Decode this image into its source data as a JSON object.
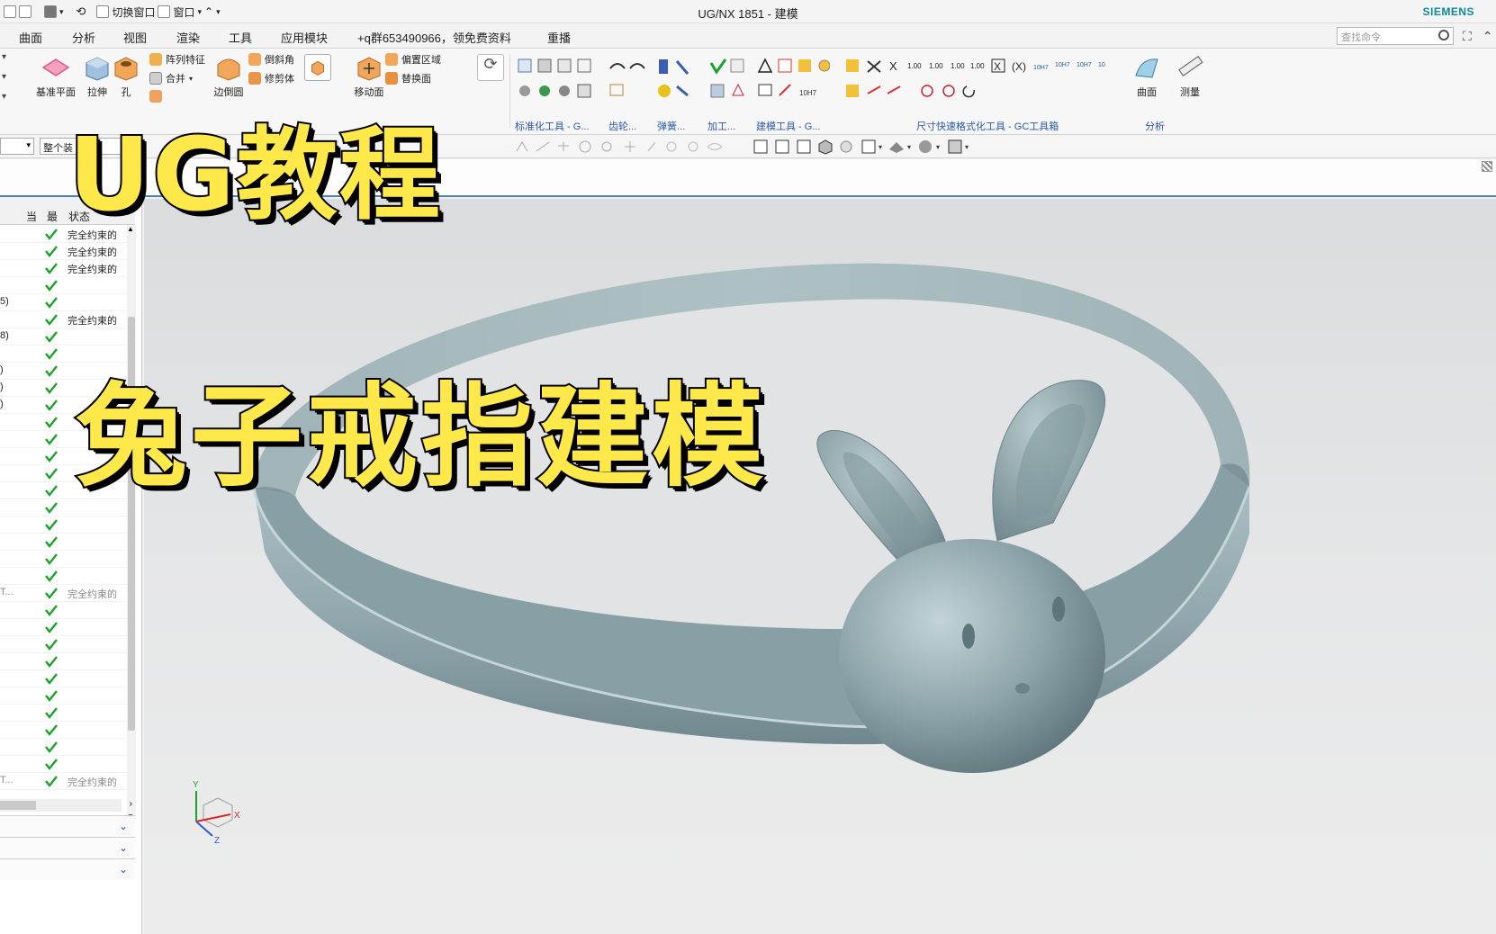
{
  "window": {
    "title": "UG/NX 1851 - 建模",
    "brand": "SIEMENS",
    "quick_access": [
      "切换窗口",
      "窗口"
    ]
  },
  "menu": {
    "items": [
      "曲面",
      "分析",
      "视图",
      "渲染",
      "工具",
      "应用模块",
      "+q群653490966，领免费资料",
      "重播"
    ],
    "search_placeholder": "查找命令"
  },
  "ribbon": {
    "big_buttons": [
      "基准平面",
      "拉伸",
      "孔",
      "边倒圆",
      "移动面",
      "曲面",
      "测量"
    ],
    "small_buttons": [
      "阵列特征",
      "合并",
      "倒斜角",
      "修剪体",
      "偏置区域",
      "替换面"
    ],
    "group_labels": [
      "标准化工具 - G...",
      "齿轮...",
      "弹簧...",
      "加工...",
      "建模工具 - G...",
      "尺寸快速格式化工具 - GC工具箱",
      "分析"
    ]
  },
  "toolbar2": {
    "scope": "整个装"
  },
  "navigator": {
    "headers": [
      "当",
      "最",
      "状态"
    ],
    "rows": [
      {
        "left": "",
        "status": "完全约束的",
        "dim": false
      },
      {
        "left": "",
        "status": "完全约束的",
        "dim": false
      },
      {
        "left": "",
        "status": "完全约束的",
        "dim": false
      },
      {
        "left": "",
        "status": "",
        "dim": false
      },
      {
        "left": "5)",
        "status": "",
        "dim": false
      },
      {
        "left": "",
        "status": "完全约束的",
        "dim": false
      },
      {
        "left": "8)",
        "status": "",
        "dim": false
      },
      {
        "left": "",
        "status": "",
        "dim": false
      },
      {
        "left": ")",
        "status": "",
        "dim": false
      },
      {
        "left": ")",
        "status": "",
        "dim": false
      },
      {
        "left": ")",
        "status": "",
        "dim": false
      },
      {
        "left": "",
        "status": "",
        "dim": false
      },
      {
        "left": "",
        "status": "",
        "dim": false
      },
      {
        "left": "",
        "status": "",
        "dim": false
      },
      {
        "left": "",
        "status": "",
        "dim": false
      },
      {
        "left": "",
        "status": "",
        "dim": false
      },
      {
        "left": "",
        "status": "",
        "dim": false
      },
      {
        "left": "",
        "status": "",
        "dim": false
      },
      {
        "left": "",
        "status": "",
        "dim": false
      },
      {
        "left": "",
        "status": "",
        "dim": false
      },
      {
        "left": "",
        "status": "",
        "dim": false
      },
      {
        "left": "T...",
        "status": "完全约束的",
        "dim": true
      },
      {
        "left": "",
        "status": "",
        "dim": false
      },
      {
        "left": "",
        "status": "",
        "dim": false
      },
      {
        "left": "",
        "status": "",
        "dim": false
      },
      {
        "left": "",
        "status": "",
        "dim": false
      },
      {
        "left": "",
        "status": "",
        "dim": false
      },
      {
        "left": "",
        "status": "",
        "dim": false
      },
      {
        "left": "",
        "status": "",
        "dim": false
      },
      {
        "left": "",
        "status": "",
        "dim": false
      },
      {
        "left": "",
        "status": "",
        "dim": false
      },
      {
        "left": "",
        "status": "",
        "dim": false
      },
      {
        "left": "T...",
        "status": "完全约束的",
        "dim": true
      }
    ]
  },
  "overlay": {
    "line1": "UG教程",
    "line2": "兔子戒指建模"
  },
  "triad": {
    "x": "X",
    "y": "Y",
    "z": "Z"
  },
  "colors": {
    "overlay_fill": "#ffe94a",
    "model": "#8fa7ad",
    "brand": "#0b8a99",
    "check": "#1aa32a"
  }
}
